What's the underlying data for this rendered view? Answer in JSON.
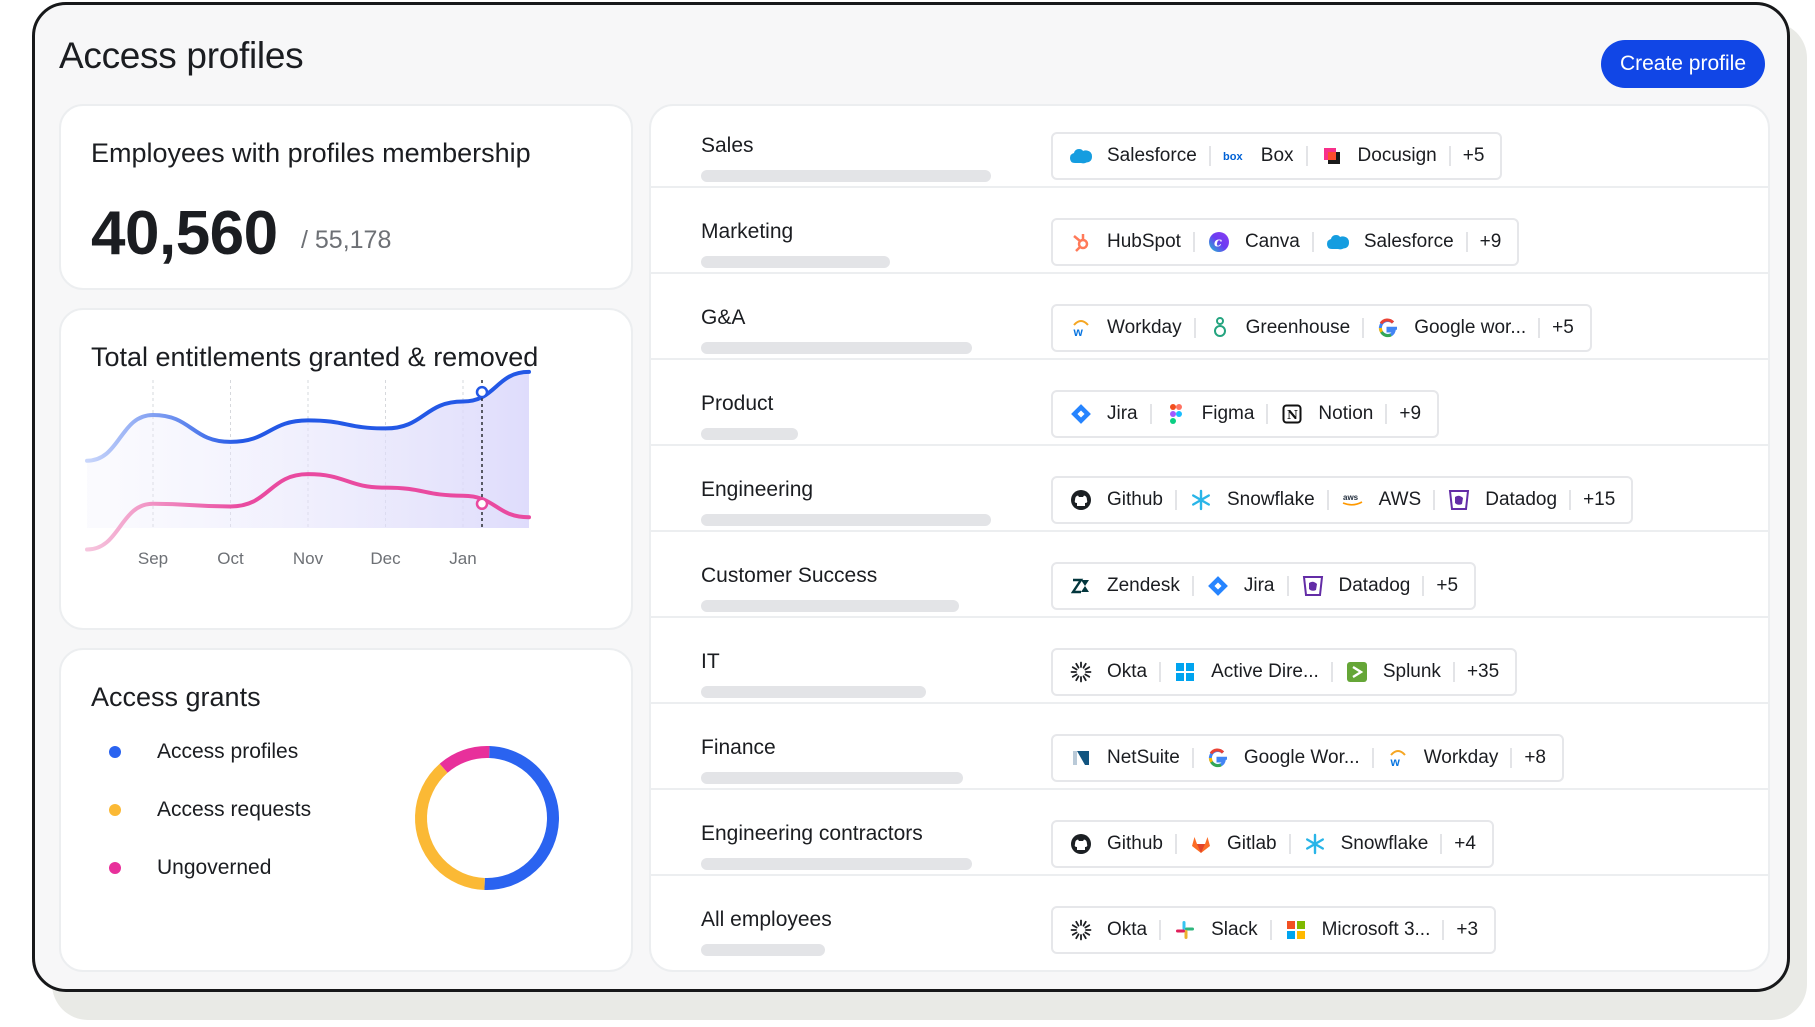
{
  "page": {
    "title": "Access profiles",
    "create_label": "Create profile"
  },
  "stats": {
    "title": "Employees with profiles membership",
    "value": "40,560",
    "total": "/ 55,178"
  },
  "chart": {
    "title": "Total entitlements granted & removed"
  },
  "chart_data": {
    "type": "line",
    "title": "Total entitlements granted & removed",
    "categories": [
      "Sep",
      "Oct",
      "Nov",
      "Dec",
      "Jan"
    ],
    "series": [
      {
        "values": [
          62,
          52,
          60,
          57,
          67
        ]
      },
      {
        "values": [
          29,
          28,
          40,
          35,
          32
        ]
      }
    ],
    "grid": "vertical dashed",
    "colors": {
      "series1": "#2358e6",
      "series2": "#e94aa0",
      "area": "#d9d6fb"
    }
  },
  "grants": {
    "title": "Access grants",
    "legend": [
      {
        "label": "Access profiles",
        "color": "#2a63f0"
      },
      {
        "label": "Access requests",
        "color": "#fbb935"
      },
      {
        "label": "Ungoverned",
        "color": "#e8309b"
      }
    ],
    "donut_values": [
      0.5,
      0.38,
      0.12
    ]
  },
  "profiles": [
    {
      "name": "Sales",
      "bar": 0.63,
      "apps": [
        {
          "name": "Salesforce",
          "icon": "salesforce-icon"
        },
        {
          "name": "Box",
          "icon": "box-icon"
        },
        {
          "name": "Docusign",
          "icon": "docusign-icon"
        }
      ],
      "more": "+5"
    },
    {
      "name": "Marketing",
      "bar": 0.41,
      "apps": [
        {
          "name": "HubSpot",
          "icon": "hubspot-icon"
        },
        {
          "name": "Canva",
          "icon": "canva-icon"
        },
        {
          "name": "Salesforce",
          "icon": "salesforce-icon"
        }
      ],
      "more": "+9"
    },
    {
      "name": "G&A",
      "bar": 0.59,
      "apps": [
        {
          "name": "Workday",
          "icon": "workday-icon"
        },
        {
          "name": "Greenhouse",
          "icon": "greenhouse-icon"
        },
        {
          "name": "Google wor...",
          "icon": "google-icon"
        }
      ],
      "more": "+5"
    },
    {
      "name": "Product",
      "bar": 0.21,
      "apps": [
        {
          "name": "Jira",
          "icon": "jira-icon"
        },
        {
          "name": "Figma",
          "icon": "figma-icon"
        },
        {
          "name": "Notion",
          "icon": "notion-icon"
        }
      ],
      "more": "+9"
    },
    {
      "name": "Engineering",
      "bar": 0.63,
      "apps": [
        {
          "name": "Github",
          "icon": "github-icon"
        },
        {
          "name": "Snowflake",
          "icon": "snowflake-icon"
        },
        {
          "name": "AWS",
          "icon": "aws-icon"
        },
        {
          "name": "Datadog",
          "icon": "datadog-icon"
        }
      ],
      "more": "+15"
    },
    {
      "name": "Customer Success",
      "bar": 0.56,
      "apps": [
        {
          "name": "Zendesk",
          "icon": "zendesk-icon"
        },
        {
          "name": "Jira",
          "icon": "jira-icon"
        },
        {
          "name": "Datadog",
          "icon": "datadog-icon"
        }
      ],
      "more": "+5"
    },
    {
      "name": "IT",
      "bar": 0.49,
      "apps": [
        {
          "name": "Okta",
          "icon": "okta-icon"
        },
        {
          "name": "Active Dire...",
          "icon": "windows-icon"
        },
        {
          "name": "Splunk",
          "icon": "splunk-icon"
        }
      ],
      "more": "+35"
    },
    {
      "name": "Finance",
      "bar": 0.57,
      "apps": [
        {
          "name": "NetSuite",
          "icon": "netsuite-icon"
        },
        {
          "name": "Google Wor...",
          "icon": "google-icon"
        },
        {
          "name": "Workday",
          "icon": "workday-icon"
        }
      ],
      "more": "+8"
    },
    {
      "name": "Engineering contractors",
      "bar": 0.59,
      "apps": [
        {
          "name": "Github",
          "icon": "github-icon"
        },
        {
          "name": "Gitlab",
          "icon": "gitlab-icon"
        },
        {
          "name": "Snowflake",
          "icon": "snowflake-icon"
        }
      ],
      "more": "+4"
    },
    {
      "name": "All employees",
      "bar": 0.27,
      "apps": [
        {
          "name": "Okta",
          "icon": "okta-icon"
        },
        {
          "name": "Slack",
          "icon": "slack-icon"
        },
        {
          "name": "Microsoft 3...",
          "icon": "microsoft-icon"
        }
      ],
      "more": "+3"
    }
  ]
}
